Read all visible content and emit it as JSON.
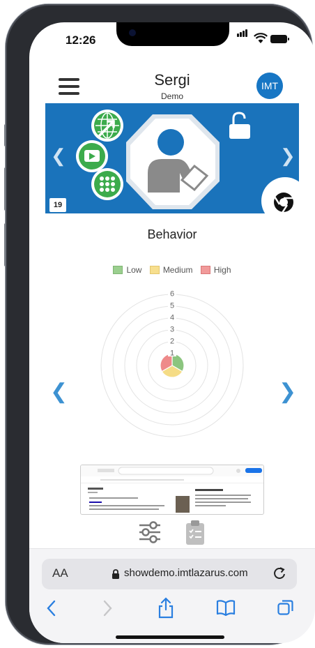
{
  "status_bar": {
    "time": "12:26"
  },
  "header": {
    "title": "Sergi",
    "subtitle": "Demo",
    "avatar_initials": "IMT"
  },
  "banner": {
    "day_badge": "19",
    "active_slide": 2,
    "slide_count": 3
  },
  "section": {
    "title": "Behavior"
  },
  "legend": {
    "items": [
      {
        "label": "Low",
        "color": "#9bcf8f"
      },
      {
        "label": "Medium",
        "color": "#f7df8e"
      },
      {
        "label": "High",
        "color": "#f19a9a"
      }
    ]
  },
  "chart_data": {
    "type": "radar",
    "ticks": [
      "1",
      "2",
      "3",
      "4",
      "5",
      "6"
    ],
    "rmax": 6,
    "series": [
      {
        "name": "Low",
        "value": 1,
        "color": "#8cc57f"
      },
      {
        "name": "Medium",
        "value": 1,
        "color": "#f5dc86"
      },
      {
        "name": "High",
        "value": 1,
        "color": "#ee8a8a"
      }
    ]
  },
  "browser": {
    "aa_label": "AA",
    "url": "showdemo.imtlazarus.com"
  },
  "icons": {
    "menu": "hamburger-menu-icon",
    "prev": "chevron-left-icon",
    "next": "chevron-right-icon",
    "lock": "lock-icon",
    "chrome": "chrome-icon",
    "settings": "sliders-icon",
    "clipboard": "clipboard-checklist-icon"
  },
  "colors": {
    "brand_blue": "#1a73bb",
    "accent_blue": "#3d92d2",
    "avatar_blue": "#1776c4"
  }
}
